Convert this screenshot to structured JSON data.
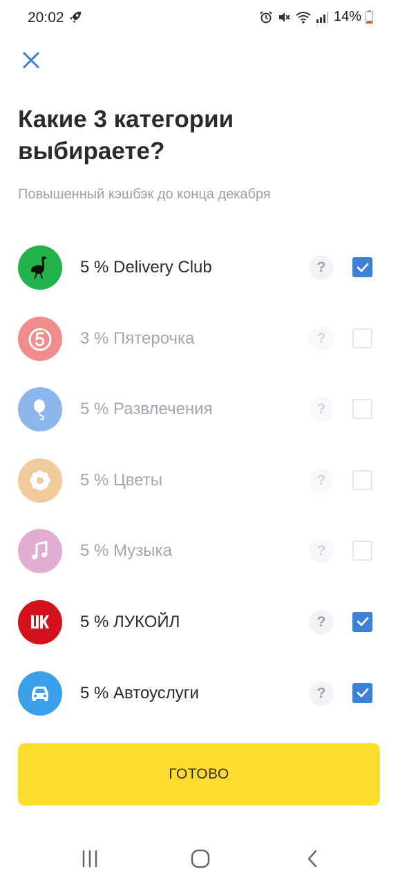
{
  "status_bar": {
    "time": "20:02",
    "battery": "14%"
  },
  "header": {
    "title": "Какие 3 категории выбираете?",
    "subtitle": "Повышенный кэшбэк до конца декабря"
  },
  "categories": [
    {
      "label": "5 % Delivery Club",
      "checked": true,
      "icon": "ostrich-icon",
      "color": "#21b24b"
    },
    {
      "label": "3 % Пятерочка",
      "checked": false,
      "icon": "pyaterochka-icon",
      "color": "#e52f2f"
    },
    {
      "label": "5 % Развлечения",
      "checked": false,
      "icon": "balloon-icon",
      "color": "#2f79db"
    },
    {
      "label": "5 % Цветы",
      "checked": false,
      "icon": "flower-icon",
      "color": "#e6a24b"
    },
    {
      "label": "5 % Музыка",
      "checked": false,
      "icon": "music-note-icon",
      "color": "#c96bb0"
    },
    {
      "label": "5 % ЛУКОЙЛ",
      "checked": true,
      "icon": "lukoil-icon",
      "color": "#d3121c"
    },
    {
      "label": "5 % Автоуслуги",
      "checked": true,
      "icon": "car-icon",
      "color": "#3aa0ea"
    }
  ],
  "help_glyph": "?",
  "done_button": "ГОТОВО",
  "colors": {
    "accent": "#3e7fd8",
    "button": "#fcdc2e",
    "close": "#3a7bd5"
  }
}
